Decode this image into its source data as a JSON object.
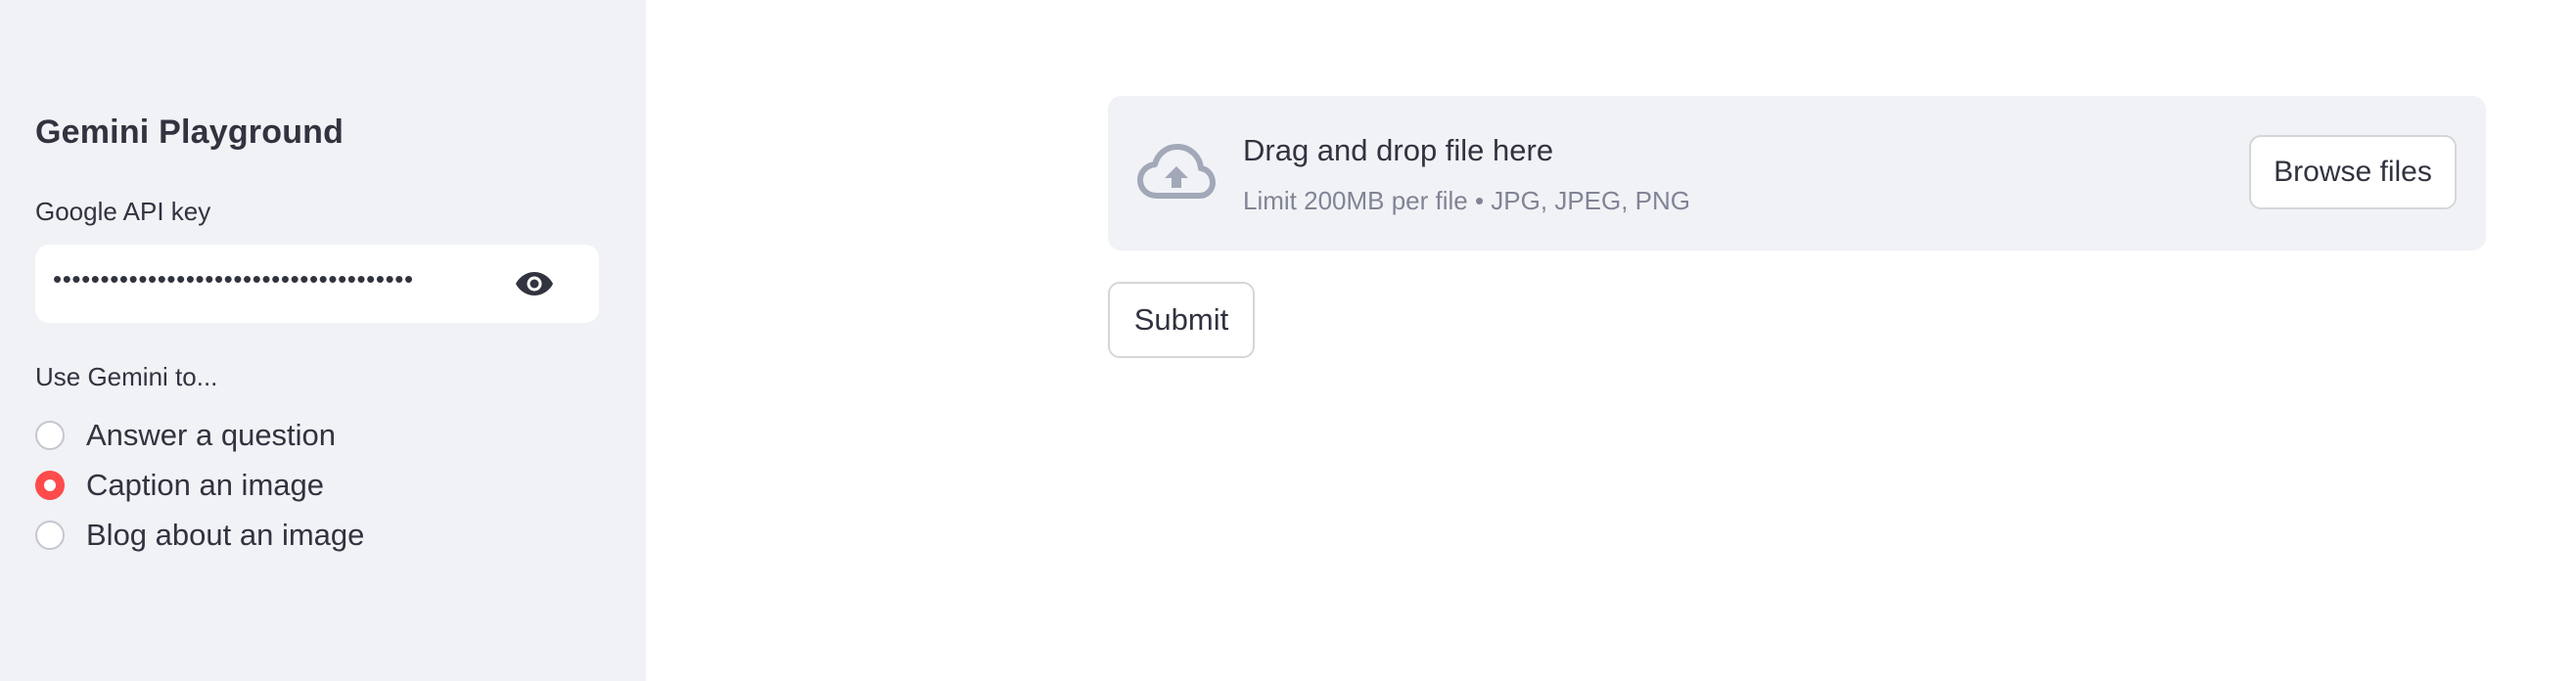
{
  "sidebar": {
    "title": "Gemini Playground",
    "api_key": {
      "label": "Google API key",
      "masked_value": "••••••••••••••••••••••••••••••••••••••",
      "toggle_icon": "eye-icon"
    },
    "mode": {
      "label": "Use Gemini to...",
      "options": [
        {
          "label": "Answer a question",
          "checked": false
        },
        {
          "label": "Caption an image",
          "checked": true
        },
        {
          "label": "Blog about an image",
          "checked": false
        }
      ]
    }
  },
  "uploader": {
    "icon": "cloud-upload-icon",
    "title": "Drag and drop file here",
    "subtitle": "Limit 200MB per file • JPG, JPEG, PNG",
    "browse_label": "Browse files"
  },
  "submit_label": "Submit",
  "colors": {
    "sidebar_bg": "#f0f2f6",
    "accent": "#ff4b4b",
    "text": "#31333f",
    "muted_text": "#808495",
    "icon": "#a3a8b8"
  }
}
